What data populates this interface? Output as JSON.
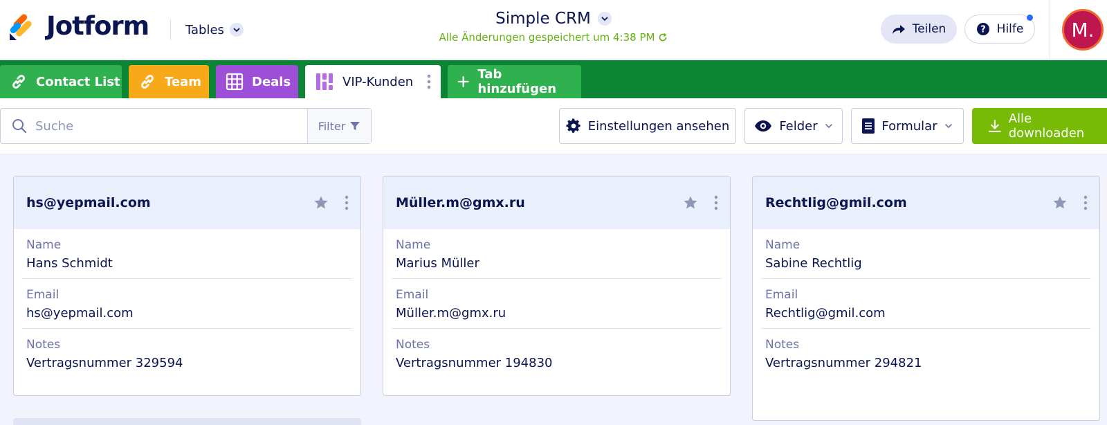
{
  "header": {
    "brand": "Jotform",
    "tables_menu": "Tables",
    "title": "Simple CRM",
    "saved_status": "Alle Änderungen gespeichert um 4:38 PM",
    "share_label": "Teilen",
    "help_label": "Hilfe",
    "avatar_initial": "M.",
    "colors": {
      "saved": "#64b20f",
      "avatar": "#c0164f",
      "avatar_ring": "#f26a2e"
    }
  },
  "tabs": [
    {
      "label": "Contact List",
      "icon": "link-icon",
      "color": "#2fb14f"
    },
    {
      "label": "Team",
      "icon": "link-icon",
      "color": "#f8a919"
    },
    {
      "label": "Deals",
      "icon": "grid-icon",
      "color": "#9d4fd8"
    },
    {
      "label": "VIP-Kunden",
      "icon": "card-view-icon",
      "active": true
    },
    {
      "label": "Tab hinzufügen",
      "icon": "plus-icon",
      "color": "#2fb14f"
    }
  ],
  "tabbar_color": "#0b8434",
  "toolbar": {
    "search_placeholder": "Suche",
    "filter_label": "Filter",
    "settings_label": "Einstellungen ansehen",
    "fields_label": "Felder",
    "form_label": "Formular",
    "download_label": "Alle downloaden",
    "download_color": "#78bb07"
  },
  "cards": [
    {
      "title": "hs@yepmail.com",
      "fields": [
        {
          "label": "Name",
          "value": "Hans Schmidt"
        },
        {
          "label": "Email",
          "value": "hs@yepmail.com"
        },
        {
          "label": "Notes",
          "value": "Vertragsnummer 329594"
        }
      ]
    },
    {
      "title": "Müller.m@gmx.ru",
      "fields": [
        {
          "label": "Name",
          "value": "Marius Müller"
        },
        {
          "label": "Email",
          "value": "Müller.m@gmx.ru"
        },
        {
          "label": "Notes",
          "value": "Vertragsnummer 194830"
        }
      ]
    },
    {
      "title": "Rechtlig@gmil.com",
      "fields": [
        {
          "label": "Name",
          "value": "Sabine Rechtlig"
        },
        {
          "label": "Email",
          "value": "Rechtlig@gmil.com"
        },
        {
          "label": "Notes",
          "value": "Vertragsnummer 294821"
        }
      ]
    }
  ]
}
